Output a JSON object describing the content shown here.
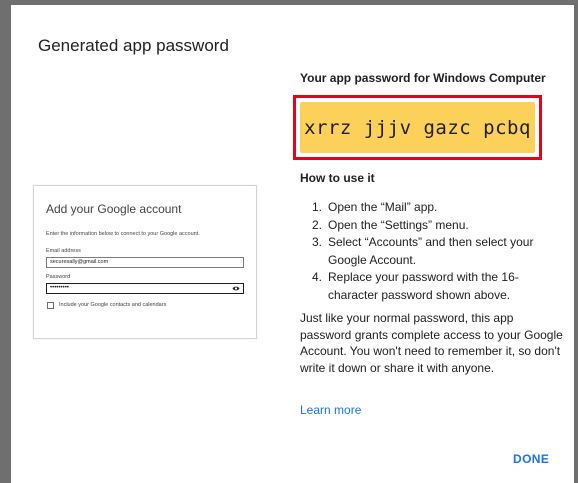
{
  "dialog": {
    "title": "Generated app password",
    "password_heading": "Your app password for Windows Computer",
    "app_password": "xrrz jjjv gazc pcbq",
    "how_to_heading": "How to use it",
    "steps": [
      {
        "num": "1.",
        "text": "Open the “Mail” app."
      },
      {
        "num": "2.",
        "text": "Open the “Settings” menu."
      },
      {
        "num": "3.",
        "text": "Select “Accounts” and then select your Google Account."
      },
      {
        "num": "4.",
        "text": "Replace your password with the 16-character password shown above."
      }
    ],
    "paragraph": "Just like your normal password, this app password grants complete access to your Google Account. You won't need to remember it, so don't write it down or share it with anyone.",
    "learn_more": "Learn more",
    "done_label": "DONE"
  },
  "illustration": {
    "title": "Add your Google account",
    "description": "Enter the information below to connect to your Google account.",
    "email_label": "Email address",
    "email_value": "securesally@gmail.com",
    "password_label": "Password",
    "password_value": "•••••••••",
    "checkbox_label": "Include your Google contacts and calendars",
    "eye_icon": "eye-icon"
  },
  "colors": {
    "password_fill": "#fcd15a",
    "highlight_border": "#e0051d",
    "link": "#1a73e8",
    "backdrop": "#6f6f6f"
  }
}
